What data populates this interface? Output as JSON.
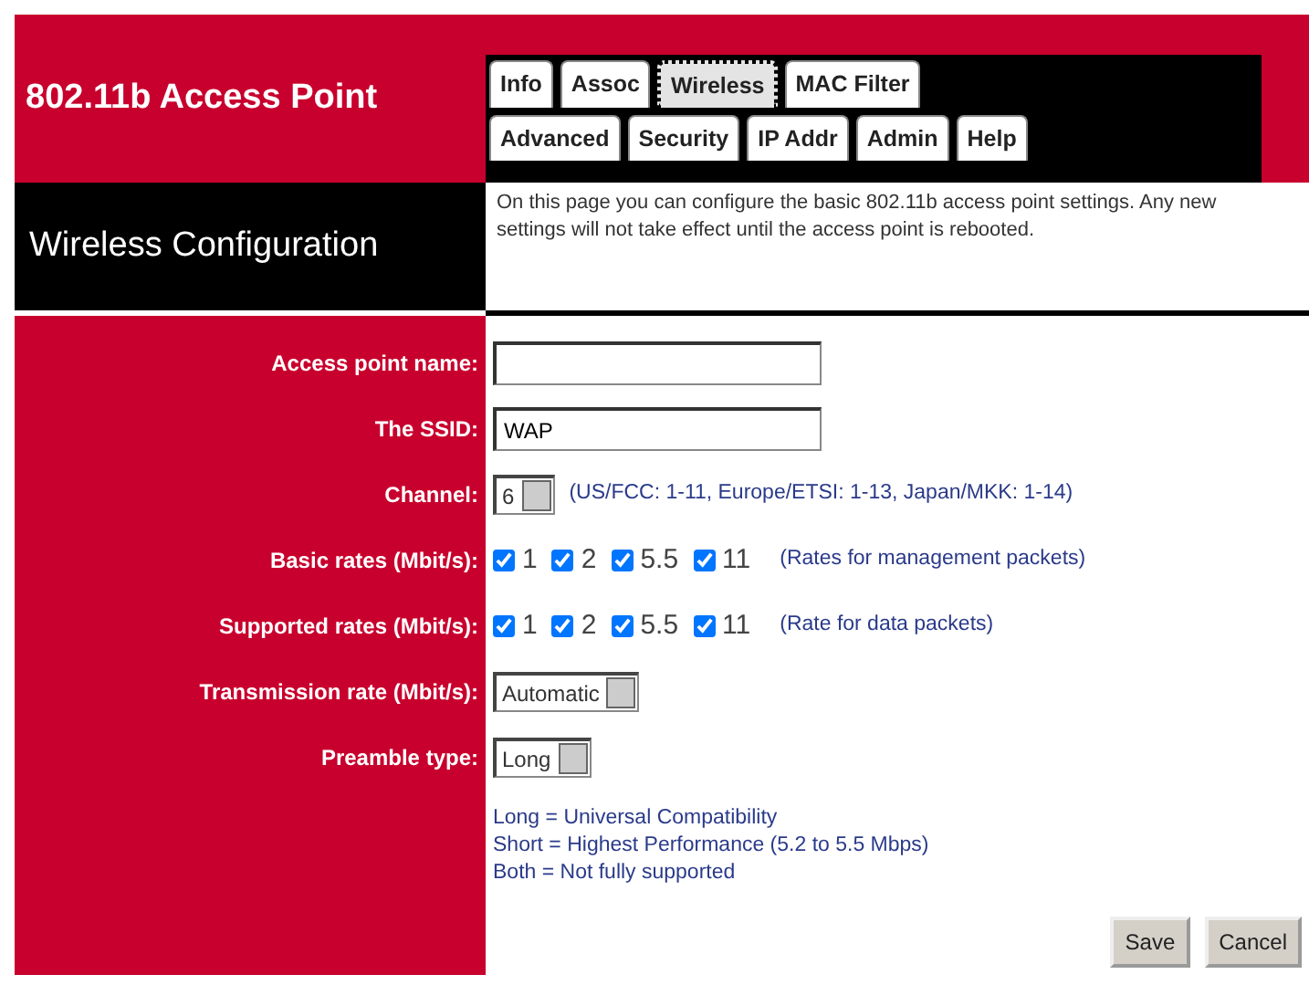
{
  "header": {
    "title": "802.11b Access Point"
  },
  "tabs": [
    {
      "label": "Info",
      "selected": false
    },
    {
      "label": "Assoc",
      "selected": false
    },
    {
      "label": "Wireless",
      "selected": true
    },
    {
      "label": "MAC Filter",
      "selected": false
    }
  ],
  "tabs_row_2": [
    {
      "label": "Advanced",
      "selected": false
    },
    {
      "label": "Security",
      "selected": false
    },
    {
      "label": "IP Addr",
      "selected": false
    },
    {
      "label": "Admin",
      "selected": false
    },
    {
      "label": "Help",
      "selected": false
    }
  ],
  "page_title": "Wireless Configuration",
  "description": "On this page you can configure the basic 802.11b access point settings. Any new settings will not take effect until the access point is rebooted.",
  "fields": [
    {
      "kind": "text",
      "label": "Access point name:"
    },
    {
      "kind": "text",
      "label": "The SSID:",
      "value": "WAP"
    },
    {
      "kind": "select",
      "label": "Channel:",
      "value": "6",
      "note": "(US/FCC: 1-11, Europe/ETSI: 1-13, Japan/MKK: 1-14)"
    },
    {
      "kind": "checks",
      "label": "Basic rates (Mbit/s):",
      "options": [
        {
          "label": "1",
          "checked": true
        },
        {
          "label": "2",
          "checked": true
        },
        {
          "label": "5.5",
          "checked": true
        },
        {
          "label": "11",
          "checked": true
        }
      ],
      "note": "(Rates for management packets)"
    },
    {
      "kind": "checks",
      "label": "Supported rates (Mbit/s):",
      "options": [
        {
          "label": "1",
          "checked": true
        },
        {
          "label": "2",
          "checked": true
        },
        {
          "label": "5.5",
          "checked": true
        },
        {
          "label": "11",
          "checked": true
        }
      ],
      "note": "(Rate for data packets)"
    },
    {
      "kind": "select",
      "label": "Transmission rate (Mbit/s):",
      "value": "Automatic"
    },
    {
      "kind": "select",
      "label": "Preamble type:",
      "value": "Long"
    }
  ],
  "preamble_legend": [
    "Long = Universal Compatibility",
    "Short = Highest Performance (5.2 to 5.5 Mbps)",
    "Both = Not fully supported"
  ],
  "buttons": [
    "Save",
    "Cancel"
  ]
}
